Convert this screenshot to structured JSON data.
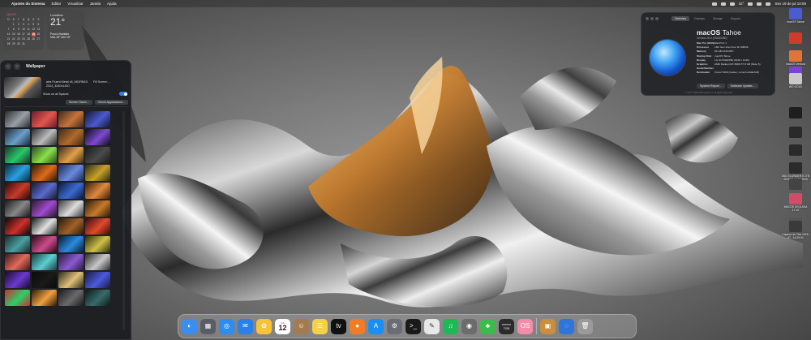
{
  "menubar": {
    "app_name": "Ajustes do Sistema",
    "menus": [
      "Editar",
      "Visualizar",
      "Janela",
      "Ajuda"
    ],
    "battery": "42°",
    "clock": "Sex 19 de jul 10:59"
  },
  "calendar_widget": {
    "month": "JULHO",
    "weekdays": [
      "D",
      "S",
      "T",
      "Q",
      "Q",
      "S",
      "S"
    ],
    "days": [
      "",
      "1",
      "2",
      "3",
      "4",
      "5",
      "6",
      "7",
      "8",
      "9",
      "10",
      "11",
      "12",
      "13",
      "14",
      "15",
      "16",
      "17",
      "18",
      "19",
      "20",
      "21",
      "22",
      "23",
      "24",
      "25",
      "26",
      "27",
      "28",
      "29",
      "30",
      "31",
      "",
      ""
    ],
    "today": "19"
  },
  "weather_widget": {
    "city": "Londrina",
    "temp": "21°",
    "condition": "Pouco Nublado",
    "hilo": "Máx 28° Mín 15°"
  },
  "wallpaper_window": {
    "title": "Wallpaper",
    "current_name": "atra Fluent Metal v8_6K3RM10 2024_3440x1440",
    "fill_mode": "Fill Screen",
    "show_spaces_label": "Show on all Spaces",
    "screen_saver_btn": "Screen Saver...",
    "check_appearance_btn": "Check Appearance..."
  },
  "about_window": {
    "tabs": [
      "Overview",
      "Displays",
      "Storage",
      "Support"
    ],
    "os_name": "macOS",
    "os_version_name": "Tahoe",
    "version": "Version 26.0 (25A5338b)",
    "specs": [
      {
        "k": "Mac Pro (2019)",
        "v": "MacPro7,1"
      },
      {
        "k": "Processor",
        "v": "16th Gen Intel Core i9 10900K"
      },
      {
        "k": "Memory",
        "v": "64 GB 2133 MHz"
      },
      {
        "k": "Startup Disk",
        "v": "macOS Tahoe"
      },
      {
        "k": "Display",
        "v": "LG ULTRAWIDE (3440 x 1440)"
      },
      {
        "k": "Graphics",
        "v": "AMD Radeon RX 6600 XT 8 GB (Mute 5)"
      },
      {
        "k": "Serial Number",
        "v": ""
      },
      {
        "k": "Bootloader",
        "v": "Clover 5160 (master, commit a3d4e5c8)"
      }
    ],
    "system_report_btn": "System Report...",
    "software_update_btn": "Software Update...",
    "footer": "™ and © 1983-2025 Apple Inc. All Rights Reserved."
  },
  "desktop_icons": [
    {
      "label": "macOS Tahoe",
      "color": "#4a5ccf"
    },
    {
      "label": "",
      "color": "#d03b2a"
    },
    {
      "label": "macOS Ventura",
      "color": "#e2743a"
    },
    {
      "label": "",
      "color": "#7c42d8"
    },
    {
      "label": "WD GOLD",
      "color": "#c9c9c9"
    },
    {
      "label": "",
      "color": "#1e1e1e"
    },
    {
      "label": "",
      "color": "#2a2a2a"
    },
    {
      "label": "",
      "color": "#2a2a2a"
    },
    {
      "label": "SSD ELONGER 8 1TB  SEAGE...5.07.2025",
      "color": "#2b2b2b"
    },
    {
      "label": "",
      "color": "#444"
    },
    {
      "label": "MACOS SEQUOIA 17.10",
      "color": "#d04d6a"
    },
    {
      "label": "",
      "color": "#555"
    },
    {
      "label": "Captura de Tela 2025-07...16.09.51",
      "color": "#3a3a3a"
    }
  ],
  "dock_apps": [
    {
      "name": "finder",
      "glyph": "◐",
      "color": "#3b8ef0"
    },
    {
      "name": "launchpad",
      "glyph": "▦",
      "color": "#5a5d66"
    },
    {
      "name": "safari",
      "glyph": "◎",
      "color": "#2d8cf0"
    },
    {
      "name": "mail",
      "glyph": "✉",
      "color": "#2a7fe8"
    },
    {
      "name": "photos",
      "glyph": "✿",
      "color": "#f6c33a"
    },
    {
      "name": "calendar",
      "glyph": "",
      "color": "#ffffff"
    },
    {
      "name": "contacts",
      "glyph": "☺",
      "color": "#a37b4e"
    },
    {
      "name": "notes",
      "glyph": "☰",
      "color": "#f5d04a"
    },
    {
      "name": "apple-tv",
      "glyph": "tv",
      "color": "#111111"
    },
    {
      "name": "firefox",
      "glyph": "●",
      "color": "#f27b25"
    },
    {
      "name": "app-store",
      "glyph": "A",
      "color": "#1a8ef3"
    },
    {
      "name": "system-settings",
      "glyph": "⚙",
      "color": "#6a6d75"
    },
    {
      "name": "terminal",
      "glyph": ">_",
      "color": "#1a1a1a"
    },
    {
      "name": "textedit",
      "glyph": "✎",
      "color": "#e8e8e8"
    },
    {
      "name": "spotify",
      "glyph": "♫",
      "color": "#1db954"
    },
    {
      "name": "screenshot",
      "glyph": "◉",
      "color": "#6c6c6c"
    },
    {
      "name": "clover-configurator",
      "glyph": "♣",
      "color": "#3cba4b"
    },
    {
      "name": "hackintool",
      "glyph": "",
      "color": "#2b2b2b"
    },
    {
      "name": "opencore",
      "glyph": "OS",
      "color": "#f38bab"
    },
    {
      "name": "archive-utility",
      "glyph": "▣",
      "color": "#c98f3f"
    },
    {
      "name": "migration",
      "glyph": "◌",
      "color": "#2f74d8"
    },
    {
      "name": "trash",
      "glyph": "🗑",
      "color": "#9a9a9a"
    }
  ],
  "dock_calendar": {
    "day": "12",
    "month": "JUL"
  },
  "dock_hackintool": {
    "line1": "WARNO",
    "line2": "7/26"
  }
}
